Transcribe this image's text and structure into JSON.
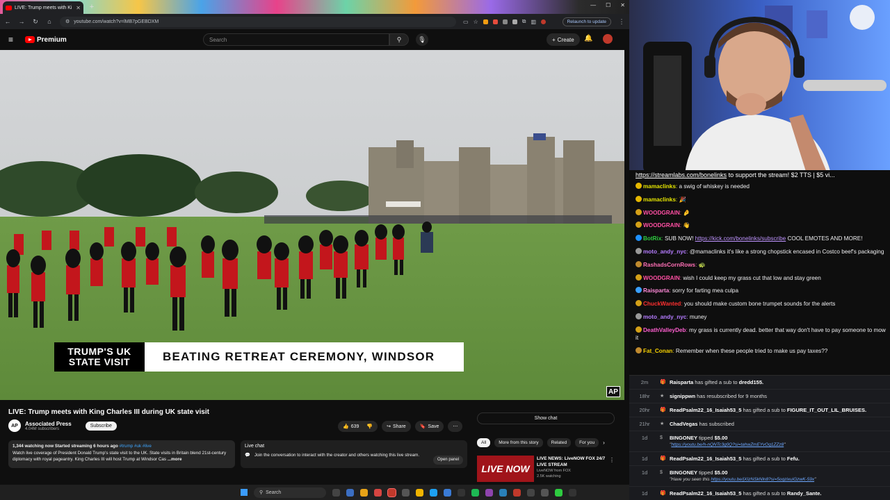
{
  "browser": {
    "tab_title": "LIVE: Trump meets with Ki",
    "url": "youtube.com/watch?v=lMB7pGEBDXM",
    "relaunch_label": "Relaunch to update"
  },
  "youtube": {
    "logo": "Premium",
    "search_placeholder": "Search",
    "create_label": "Create"
  },
  "video": {
    "lower_third_left_line1": "TRUMP'S UK",
    "lower_third_left_line2": "STATE VISIT",
    "lower_third_headline": "BEATING RETREAT CEREMONY, WINDSOR",
    "corner_logo": "AP",
    "title": "LIVE: Trump meets with King Charles III during UK state visit"
  },
  "channel": {
    "name": "Associated Press",
    "subscribers": "4.04M subscribers",
    "subscribe_label": "Subscribe",
    "avatar_text": "AP"
  },
  "actions": {
    "likes": "639",
    "share_label": "Share",
    "save_label": "Save",
    "show_chat_label": "Show chat"
  },
  "description": {
    "stats": "1,344 watching now  Started streaming 6 hours ago",
    "tags": "#trump #uk #live",
    "text": "Watch live coverage of President Donald Trump's state visit to the UK. State visits in Britain blend 21st-century diplomacy with royal pageantry. King Charles III will host Trump at Windsor Cas",
    "more_label": "...more"
  },
  "live_chat_box": {
    "heading": "Live chat",
    "text": "Join the conversation to interact with the creator and others watching this live stream.",
    "open_panel_label": "Open panel"
  },
  "chips": [
    "All",
    "More from this story",
    "Related",
    "For you"
  ],
  "recommendation": {
    "thumb_text": "LIVE NOW",
    "title": "LIVE NEWS: LiveNOW FOX 24/7 LIVE STREAM",
    "channel": "LiveNOW from FOX",
    "watching": "2.5K watching"
  },
  "taskbar": {
    "search_label": "Search"
  },
  "stream_banner": {
    "link": "https://streamlabs.com/bonelinks",
    "text": " to support the stream! $2 TTS | $5 vi..."
  },
  "chat": [
    {
      "user": "mamaclinks",
      "color": "#e6e600",
      "badge": "#e6b800",
      "text": "a swig of whiskey is needed"
    },
    {
      "user": "mamaclinks",
      "color": "#e6e600",
      "badge": "#e6b800",
      "text": "🎉"
    },
    {
      "user": "WOODGRAIN",
      "color": "#ff4fa3",
      "badge": "#d4a017",
      "text": "🤌"
    },
    {
      "user": "WOODGRAIN",
      "color": "#ff4fa3",
      "badge": "#d4a017",
      "text": "👋"
    },
    {
      "user": "BotRix",
      "color": "#2ecc40",
      "badge": "#1e90ff",
      "text": "SUB NOW! ",
      "link": "https://kick.com/bonelinks/subscribe",
      "after": " COOL EMOTES AND MORE!"
    },
    {
      "user": "moto_andy_nyc",
      "color": "#b57cff",
      "badge": "#999",
      "text": "@mamaclinks it's like a strong chopstick encased in Costco beef's packaging"
    },
    {
      "user": "RashadsCornRows",
      "color": "#ff6fb5",
      "badge": "#c08a2e",
      "text": "🐢"
    },
    {
      "user": "WOODGRAIN",
      "color": "#ff4fa3",
      "badge": "#d4a017",
      "text": "wish I could keep my grass cut that low and stay green"
    },
    {
      "user": "Raisparta",
      "color": "#ff8ad8",
      "badge": "#3aa0ff",
      "text": "sorry for farting mea culpa"
    },
    {
      "user": "ChuckWanted",
      "color": "#ff3030",
      "badge": "#d4a017",
      "text": "you should make custom bone trumpet sounds for the alerts"
    },
    {
      "user": "moto_andy_nyc",
      "color": "#b57cff",
      "badge": "#999",
      "text": "muney"
    },
    {
      "user": "DeathValleyDeb",
      "color": "#ff5fd0",
      "badge": "#d4a017",
      "text": "my grass is currently dead. better that way don't have to pay someone to mow it"
    },
    {
      "user": "Fat_Conan",
      "color": "#f5d000",
      "badge": "#c08a2e",
      "text": "Remember when these people tried to make us pay taxes??"
    }
  ],
  "events": [
    {
      "time": "2m",
      "icon": "🎁",
      "user": "Raisparta",
      "text": " has gifted a sub to ",
      "target": "dredd155."
    },
    {
      "time": "18hr",
      "icon": "★",
      "user": "signippwn",
      "text": " has resubscribed for 9 months",
      "target": ""
    },
    {
      "time": "20hr",
      "icon": "🎁",
      "user": "ReadPsalm22_16_Isaiah53_5",
      "text": " has gifted a sub to ",
      "target": "FIGURE_IT_OUT_LIL_BRUISES."
    },
    {
      "time": "21hr",
      "icon": "★",
      "user": "ChadVegas",
      "text": " has subscribed",
      "target": ""
    },
    {
      "time": "1d",
      "icon": "$",
      "user": "BINGONEY",
      "text": " tipped ",
      "target": "$5.00",
      "sub_prefix": "\"",
      "sub_link": "https://youtu.be/h-nQNTc3g0Q?si=tahwZmEYvOq1ZZz8",
      "sub_suffix": "\""
    },
    {
      "time": "1d",
      "icon": "🎁",
      "user": "ReadPsalm22_16_Isaiah53_5",
      "text": " has gifted a sub to ",
      "target": "Fefu."
    },
    {
      "time": "1d",
      "icon": "$",
      "user": "BINGONEY",
      "text": " tipped ",
      "target": "$5.00",
      "sub_prefix": "\"Have you seen this ",
      "sub_link": "https://youtu.be/jXIzNSkNln8?si=5oqzixuiGzwK-59x",
      "sub_suffix": "\""
    },
    {
      "time": "1d",
      "icon": "🎁",
      "user": "ReadPsalm22_16_Isaiah53_5",
      "text": " has gifted a sub to ",
      "target": "Randy_Sante."
    }
  ]
}
